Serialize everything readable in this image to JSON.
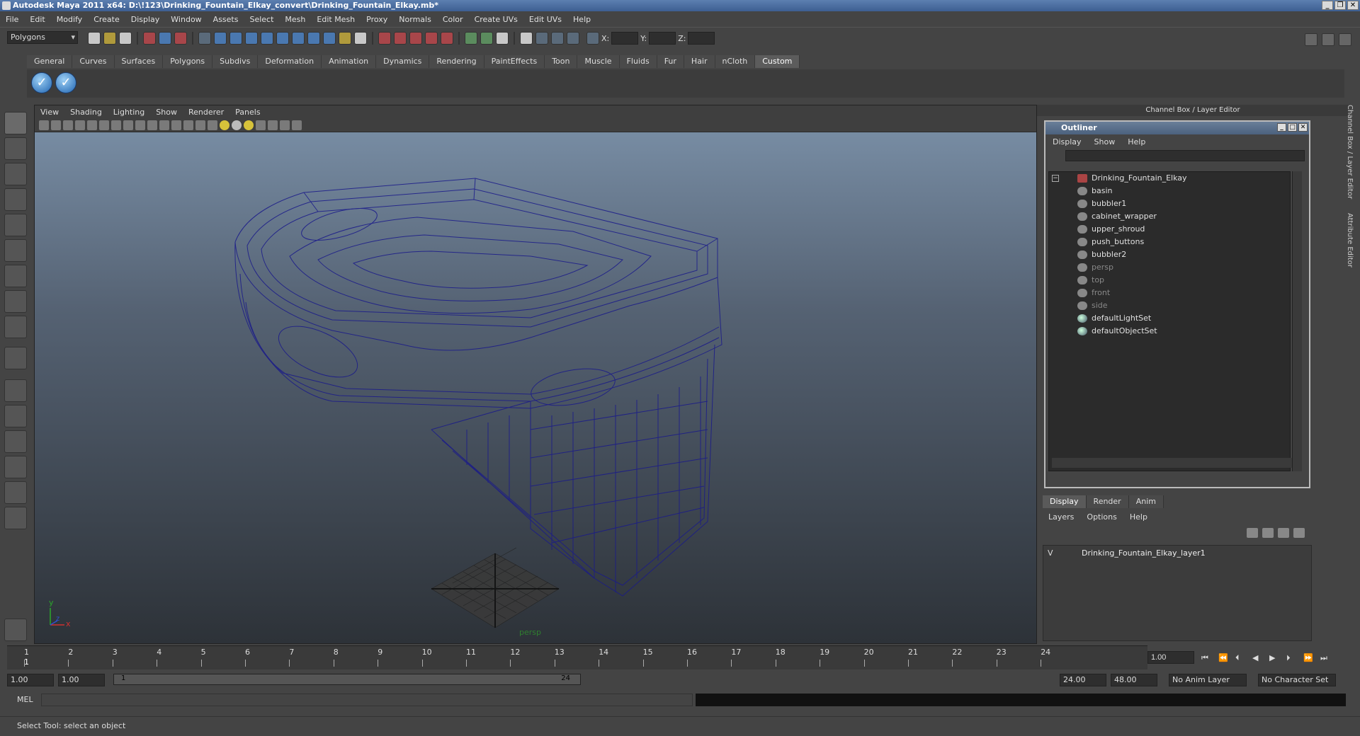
{
  "title": "Autodesk Maya 2011 x64: D:\\!123\\Drinking_Fountain_Elkay_convert\\Drinking_Fountain_Elkay.mb*",
  "menus": [
    "File",
    "Edit",
    "Modify",
    "Create",
    "Display",
    "Window",
    "Assets",
    "Select",
    "Mesh",
    "Edit Mesh",
    "Proxy",
    "Normals",
    "Color",
    "Create UVs",
    "Edit UVs",
    "Help"
  ],
  "toolbar": {
    "mode": "Polygons",
    "x_label": "X:",
    "y_label": "Y:",
    "z_label": "Z:"
  },
  "shelf_tabs": [
    "General",
    "Curves",
    "Surfaces",
    "Polygons",
    "Subdivs",
    "Deformation",
    "Animation",
    "Dynamics",
    "Rendering",
    "PaintEffects",
    "Toon",
    "Muscle",
    "Fluids",
    "Fur",
    "Hair",
    "nCloth",
    "Custom"
  ],
  "viewport": {
    "menus": [
      "View",
      "Shading",
      "Lighting",
      "Show",
      "Renderer",
      "Panels"
    ],
    "camera_label": "persp",
    "axis_y": "y",
    "axis_x": "x",
    "axis_z": "z"
  },
  "channel_box_title": "Channel Box / Layer Editor",
  "outliner": {
    "title": "Outliner",
    "menus": [
      "Display",
      "Show",
      "Help"
    ],
    "items": [
      {
        "label": "Drinking_Fountain_Elkay"
      },
      {
        "label": "basin"
      },
      {
        "label": "bubbler1"
      },
      {
        "label": "cabinet_wrapper"
      },
      {
        "label": "upper_shroud"
      },
      {
        "label": "push_buttons"
      },
      {
        "label": "bubbler2"
      },
      {
        "label": "persp"
      },
      {
        "label": "top"
      },
      {
        "label": "front"
      },
      {
        "label": "side"
      },
      {
        "label": "defaultLightSet"
      },
      {
        "label": "defaultObjectSet"
      }
    ]
  },
  "layer_editor": {
    "tabs": [
      "Display",
      "Render",
      "Anim"
    ],
    "menus": [
      "Layers",
      "Options",
      "Help"
    ],
    "visible_flag": "V",
    "layer_name": "Drinking_Fountain_Elkay_layer1"
  },
  "side_tabs": [
    "Channel Box / Layer Editor",
    "Attribute Editor"
  ],
  "timeline": {
    "ticks": [
      "1",
      "2",
      "3",
      "4",
      "5",
      "6",
      "7",
      "8",
      "9",
      "10",
      "11",
      "12",
      "13",
      "14",
      "15",
      "16",
      "17",
      "18",
      "19",
      "20",
      "21",
      "22",
      "23",
      "24"
    ],
    "current_frame": "1",
    "current_time": "1.00"
  },
  "range": {
    "start": "1.00",
    "playback_start": "1.00",
    "slider_start": "1",
    "slider_end": "24",
    "playback_end": "24.00",
    "end": "48.00",
    "anim_layer": "No Anim Layer",
    "char_set": "No Character Set"
  },
  "command_line": {
    "label": "MEL"
  },
  "status": {
    "help": "Select Tool: select an object"
  }
}
